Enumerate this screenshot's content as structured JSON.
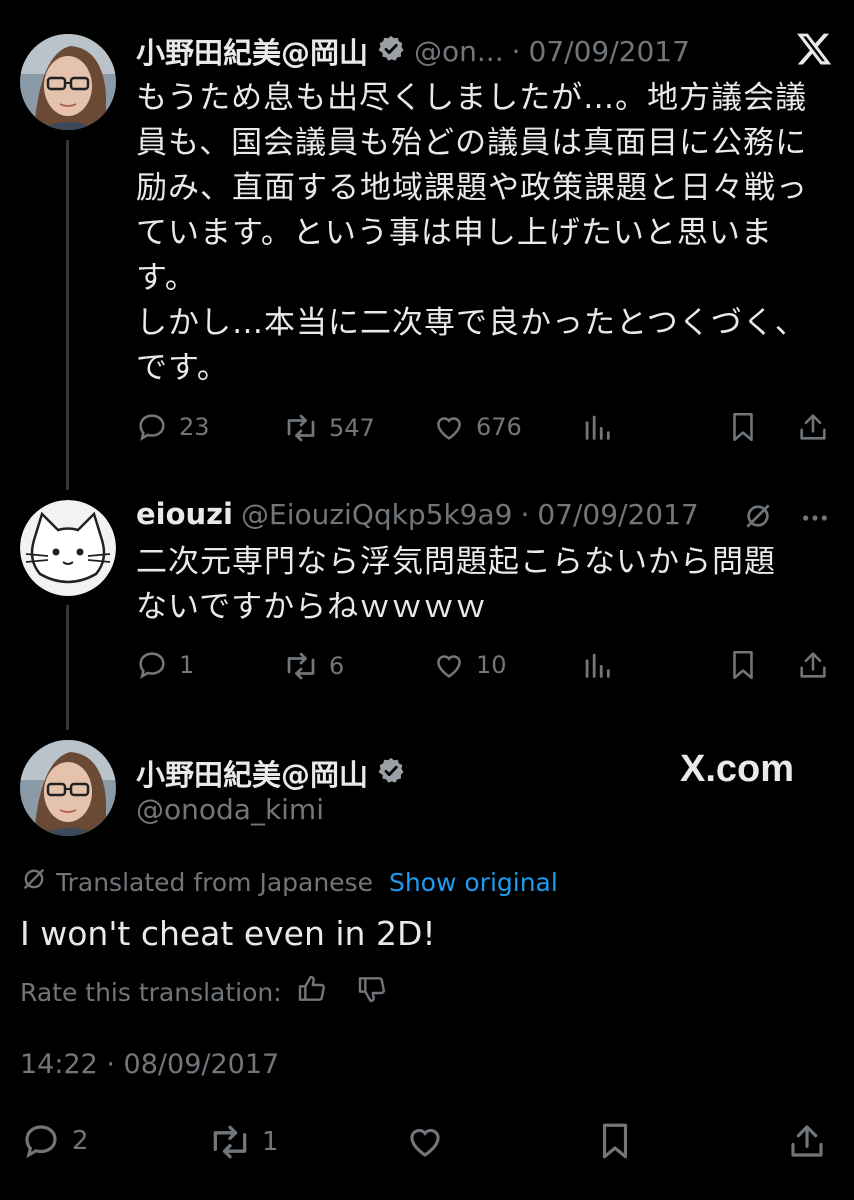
{
  "tweet1": {
    "display_name": "小野田紀美@岡山",
    "handle": "@on...",
    "date": "07/09/2017",
    "lines": [
      "もうため息も出尽くしましたが…。地方議会議",
      "員も、国会議員も殆どの議員は真面目に公務に",
      "励み、直面する地域課題や政策課題と日々戦っ",
      "ています。という事は申し上げたいと思いま",
      "す。",
      "しかし…本当に二次専で良かったとつくづく、",
      "です。"
    ],
    "replies": "23",
    "reposts": "547",
    "likes": "676"
  },
  "tweet2": {
    "display_name": "eiouzi",
    "handle": "@EiouziQqkp5k9a9",
    "date": "07/09/2017",
    "lines": [
      "二次元専門なら浮気問題起こらないから問題",
      "ないですからねｗｗｗｗ"
    ],
    "replies": "1",
    "reposts": "6",
    "likes": "10"
  },
  "tweet3": {
    "display_name": "小野田紀美@岡山",
    "handle": "@onoda_kimi",
    "translated_label": "Translated from Japanese",
    "show_original": "Show original",
    "text": "I won't cheat even in 2D!",
    "rate_label": "Rate this translation:",
    "timestamp": "14:22 · 08/09/2017",
    "replies": "2",
    "reposts": "1"
  },
  "watermark": "X.com",
  "icons": [
    "x-logo-icon",
    "reply-icon",
    "repost-icon",
    "like-icon",
    "views-icon",
    "bookmark-icon",
    "share-icon",
    "verified-icon",
    "translate-icon",
    "more-icon",
    "thumbs-up-icon",
    "thumbs-down-icon"
  ],
  "colors": {
    "background": "#000000",
    "text": "#e7e9ea",
    "secondary": "#71767b",
    "link": "#1d9bf0",
    "thread": "#333639"
  }
}
